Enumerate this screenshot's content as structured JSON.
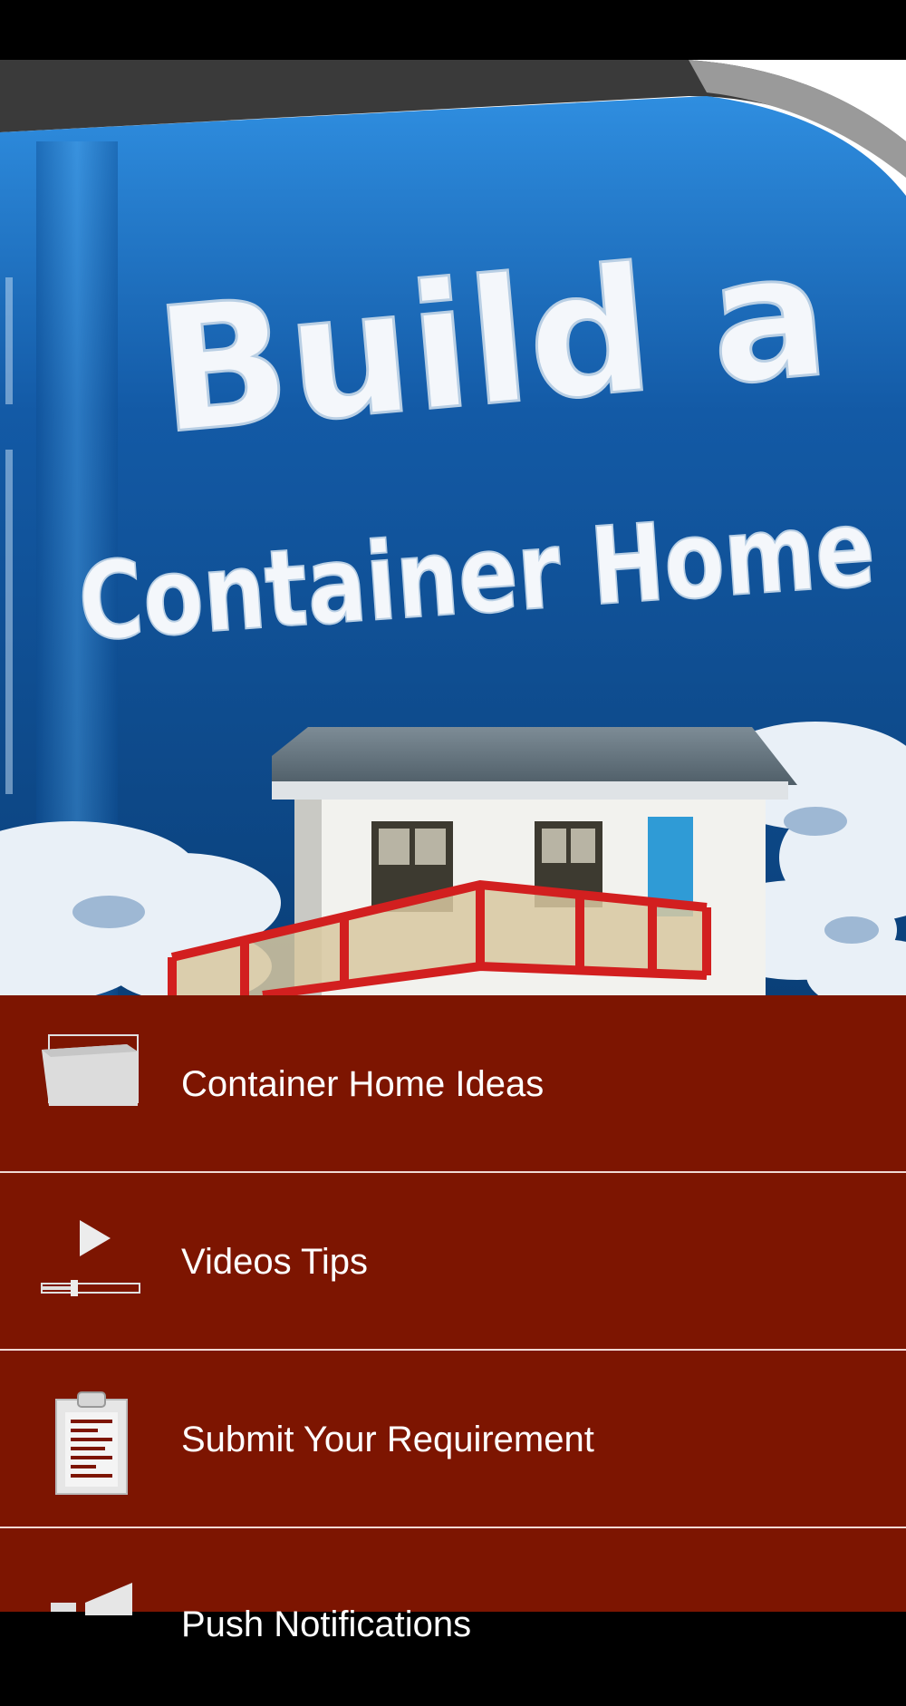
{
  "banner": {
    "title_line1": "Build a",
    "title_line2": "Container Home"
  },
  "menu": {
    "items": [
      {
        "label": "Container Home Ideas",
        "icon": "folder-icon"
      },
      {
        "label": "Videos Tips",
        "icon": "video-play-icon"
      },
      {
        "label": "Submit Your Requirement",
        "icon": "clipboard-icon"
      },
      {
        "label": "Push Notifications",
        "icon": "notification-icon"
      }
    ]
  },
  "colors": {
    "menu_background": "#7d1501",
    "banner_blue": "#0b4a8a",
    "divider": "#f1d9d4",
    "label_text": "#ffffff"
  }
}
